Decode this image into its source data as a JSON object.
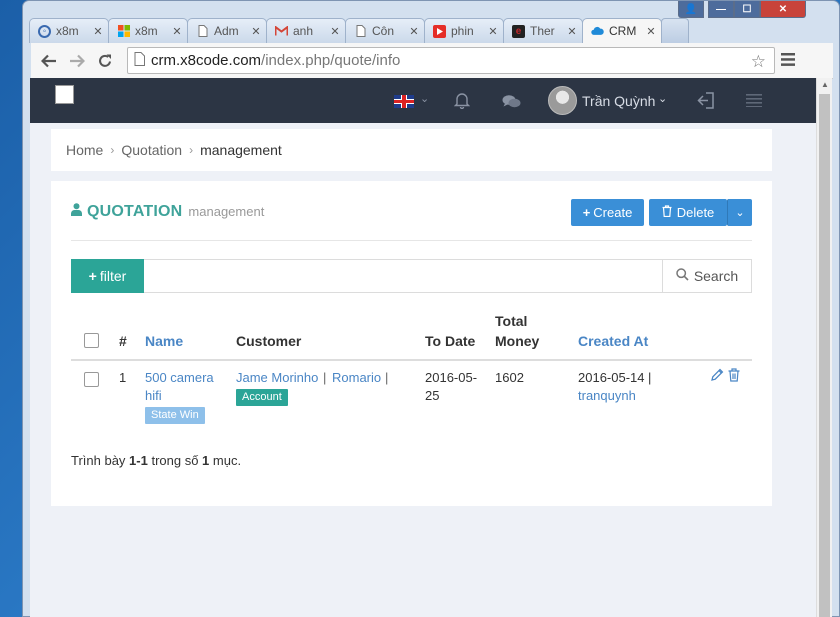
{
  "window": {
    "controls": [
      "👤",
      "—",
      "☐",
      "✕"
    ]
  },
  "tabs": [
    {
      "icon": "shield-icon",
      "label": "x8m",
      "color": "#3a6ab0"
    },
    {
      "icon": "windows-icon",
      "label": "x8m",
      "color": "#e05b2a"
    },
    {
      "icon": "document-icon",
      "label": "Adm",
      "color": "#777777"
    },
    {
      "icon": "gmail-icon",
      "label": "anh",
      "color": "#d44638"
    },
    {
      "icon": "document-icon",
      "label": "Côn",
      "color": "#777777"
    },
    {
      "icon": "youtube-icon",
      "label": "phin",
      "color": "#e52d27"
    },
    {
      "icon": "e-icon",
      "label": "Ther",
      "color": "#c0262b"
    },
    {
      "icon": "cloud-icon",
      "label": "CRM",
      "color": "#1f8ad8",
      "active": true
    }
  ],
  "address": {
    "host": "crm.x8code.com",
    "path": "/index.php/quote/info"
  },
  "appbar": {
    "username": "Trần Quỳnh"
  },
  "breadcrumb": {
    "home": "Home",
    "section": "Quotation",
    "current": "management"
  },
  "page": {
    "title": "QUOTATION",
    "subtitle": "management",
    "create_label": "Create",
    "delete_label": "Delete",
    "filter_label": "filter",
    "search_label": "Search"
  },
  "table": {
    "headers": {
      "index": "#",
      "name": "Name",
      "customer": "Customer",
      "to_date": "To Date",
      "total_money_line1": "Total",
      "total_money_line2": "Money",
      "created_at": "Created At"
    },
    "rows": [
      {
        "index": "1",
        "name_line1": "500 camera",
        "name_line2": "hifi",
        "state": "State Win",
        "customer_a": "Jame Morinho",
        "customer_b": "Romario",
        "customer_sep1": "|",
        "customer_sep2": "|",
        "customer_tag": "Account",
        "to_date_line1": "2016-05-",
        "to_date_line2": "25",
        "total_money": "1602",
        "created_date": "2016-05-14",
        "created_sep": "|",
        "created_by": "tranquynh"
      }
    ]
  },
  "footer": {
    "prefix": "Trình bày ",
    "range": "1-1",
    "middle": " trong số ",
    "total": "1",
    "suffix": " mục."
  },
  "colors": {
    "accent_teal": "#3fa39a",
    "button_blue": "#3a8fd7",
    "link_blue": "#4a86c5",
    "state_badge": "#8ec0ea",
    "account_badge": "#2ba597",
    "appbar": "#2c3544"
  }
}
